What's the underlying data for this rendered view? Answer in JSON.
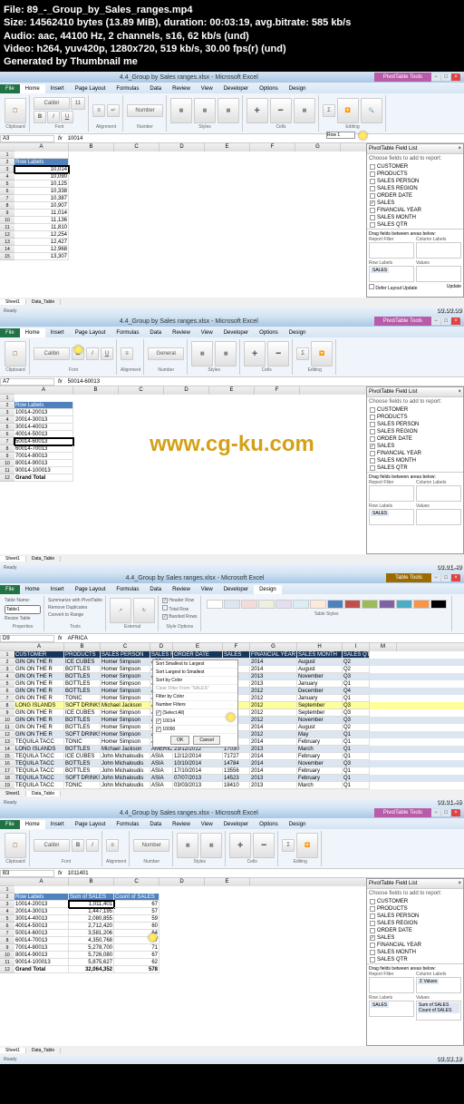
{
  "meta": {
    "file_line": "File: 89_-_Group_by_Sales_ranges.mp4",
    "size_line": "Size: 14562410 bytes (13.89 MiB), duration: 00:03:19, avg.bitrate: 585 kb/s",
    "audio_line": "Audio: aac, 44100 Hz, 2 channels, s16, 62 kb/s (und)",
    "video_line": "Video: h264, yuv420p, 1280x720, 519 kb/s, 30.00 fps(r) (und)",
    "gen_line": "Generated by Thumbnail me"
  },
  "watermark": "www.cg-ku.com",
  "title": "4.4_Group by Sales ranges.xlsx - Microsoft Excel",
  "pivot_tools": "PivotTable Tools",
  "tabs": [
    "File",
    "Home",
    "Insert",
    "Page Layout",
    "Formulas",
    "Data",
    "Review",
    "View",
    "Developer",
    "Options",
    "Design"
  ],
  "field_list": {
    "title": "PivotTable Field List",
    "prompt": "Choose fields to add to report:",
    "fields": [
      "CUSTOMER",
      "PRODUCTS",
      "SALES PERSON",
      "SALES REGION",
      "ORDER DATE",
      "SALES",
      "FINANCIAL YEAR",
      "SALES MONTH",
      "SALES QTR"
    ],
    "drag_label": "Drag fields between areas below:",
    "report_filter": "Report Filter",
    "column_labels": "Column Labels",
    "row_labels": "Row Labels",
    "values": "Values",
    "defer": "Defer Layout Update",
    "update": "Update"
  },
  "panel1": {
    "name_box": "A3",
    "formula": "10014",
    "row_labels_header": "Row Labels",
    "rows": [
      "10,014",
      "10,090",
      "10,125",
      "10,338",
      "10,387",
      "10,907",
      "11,014",
      "11,136",
      "11,810",
      "12,254",
      "12,427",
      "12,968",
      "13,307"
    ],
    "row1_input": "Row 1",
    "timestamp": "00.00.00"
  },
  "panel2": {
    "name_box": "A7",
    "formula": "50014-60013",
    "header": "Row Labels",
    "rows": [
      "10014-20013",
      "20014-30013",
      "30014-40013",
      "40014-50013",
      "50014-60013",
      "60014-70013",
      "70014-80013",
      "80014-90013",
      "90014-100013",
      "Grand Total"
    ],
    "timestamp": "00.01.40"
  },
  "panel3": {
    "name_box": "D9",
    "formula": "AFRICA",
    "headers": [
      "CUSTOMER",
      "PRODUCTS",
      "SALES PERSON",
      "SALES REGION",
      "ORDER DATE",
      "SALES",
      "FINANCIAL YEAR",
      "SALES MONTH",
      "SALES QTR"
    ],
    "rows": [
      {
        "customer": "GIN ON THE R",
        "prod": "ICE CUBES",
        "person": "Homer Simpson",
        "region": "AFRI",
        "year": "2014",
        "month": "August",
        "qtr": "Q2"
      },
      {
        "customer": "GIN ON THE R",
        "prod": "BOTTLES",
        "person": "Homer Simpson",
        "region": "AFRI",
        "year": "2014",
        "month": "August",
        "qtr": "Q2"
      },
      {
        "customer": "GIN ON THE R",
        "prod": "BOTTLES",
        "person": "Homer Simpson",
        "region": "AFRI",
        "year": "2013",
        "month": "November",
        "qtr": "Q3"
      },
      {
        "customer": "GIN ON THE R",
        "prod": "BOTTLES",
        "person": "Homer Simpson",
        "region": "AFRI",
        "year": "2013",
        "month": "January",
        "qtr": "Q1"
      },
      {
        "customer": "GIN ON THE R",
        "prod": "BOTTLES",
        "person": "Homer Simpson",
        "region": "AFRI",
        "year": "2012",
        "month": "December",
        "qtr": "Q4"
      },
      {
        "customer": "GIN ON THE R",
        "prod": "TONIC",
        "person": "Homer Simpson",
        "region": "AFRI",
        "year": "2012",
        "month": "January",
        "qtr": "Q1"
      },
      {
        "customer": "LONG ISLANDS",
        "prod": "SOFT DRINKS",
        "person": "Michael Jackson",
        "region": "AME",
        "year": "2012",
        "month": "September",
        "qtr": "Q3"
      },
      {
        "customer": "GIN ON THE R",
        "prod": "ICE CUBES",
        "person": "Homer Simpson",
        "region": "AFRI",
        "year": "2012",
        "month": "September",
        "qtr": "Q3"
      },
      {
        "customer": "GIN ON THE R",
        "prod": "BOTTLES",
        "person": "Homer Simpson",
        "region": "AFRI",
        "year": "2012",
        "month": "November",
        "qtr": "Q3"
      },
      {
        "customer": "GIN ON THE R",
        "prod": "BOTTLES",
        "person": "Homer Simpson",
        "region": "AFRI",
        "year": "2014",
        "month": "August",
        "qtr": "Q2"
      },
      {
        "customer": "GIN ON THE R",
        "prod": "SOFT DRINKS",
        "person": "Homer Simpson",
        "region": "AFRI",
        "year": "2012",
        "month": "May",
        "qtr": "Q1"
      },
      {
        "customer": "TEQUILA TACC",
        "prod": "TONIC",
        "person": "Homer Simpson",
        "region": "AFRI",
        "year": "2014",
        "month": "February",
        "qtr": "Q1"
      }
    ],
    "extra_rows": [
      {
        "customer": "LONG ISLANDS",
        "prod": "BOTTLES",
        "person": "Michael Jackson",
        "region": "AMERICAS",
        "date": "23/12/2012",
        "sales": "17030",
        "year": "2013",
        "month": "March",
        "qtr": "Q1"
      },
      {
        "customer": "TEQUILA TACC",
        "prod": "ICE CUBES",
        "person": "John Michaloudis",
        "region": "ASIA",
        "date": "12/12/2014",
        "sales": "71727",
        "year": "2014",
        "month": "February",
        "qtr": "Q1"
      },
      {
        "customer": "TEQUILA TACC",
        "prod": "BOTTLES",
        "person": "John Michaloudis",
        "region": "ASIA",
        "date": "10/10/2014",
        "sales": "14784",
        "year": "2014",
        "month": "November",
        "qtr": "Q3"
      },
      {
        "customer": "TEQUILA TACC",
        "prod": "BOTTLES",
        "person": "John Michaloudis",
        "region": "ASIA",
        "date": "17/10/2014",
        "sales": "13556",
        "year": "2014",
        "month": "February",
        "qtr": "Q1"
      },
      {
        "customer": "TEQUILA TACC",
        "prod": "SOFT DRINKS",
        "person": "John Michaloudis",
        "region": "ASIA",
        "date": "07/07/2013",
        "sales": "14523",
        "year": "2013",
        "month": "February",
        "qtr": "Q1"
      },
      {
        "customer": "TEQUILA TACC",
        "prod": "TONIC",
        "person": "John Michaloudis",
        "region": "ASIA",
        "date": "03/03/2013",
        "sales": "18410",
        "year": "2013",
        "month": "March",
        "qtr": "Q1"
      }
    ],
    "filter": {
      "sort_asc": "Sort Smallest to Largest",
      "sort_desc": "Sort Largest to Smallest",
      "sort_color": "Sort by Color",
      "clear": "Clear Filter From \"SALES\"",
      "filter_color": "Filter by Color",
      "number_filters": "Number Filters",
      "select_all": "(Select All)",
      "v1": "10014",
      "v2": "10090",
      "ok": "OK",
      "cancel": "Cancel"
    },
    "timestamp": "00.01.46"
  },
  "panel4": {
    "name_box": "B3",
    "formula": "1011401",
    "headers": [
      "Row Labels",
      "Sum of SALES",
      "Count of SALES"
    ],
    "rows": [
      {
        "label": "10014-20013",
        "sum": "1,011,401",
        "count": "67"
      },
      {
        "label": "20014-30013",
        "sum": "1,447,195",
        "count": "57"
      },
      {
        "label": "30014-40013",
        "sum": "2,080,855",
        "count": "59"
      },
      {
        "label": "40014-50013",
        "sum": "2,712,420",
        "count": "60"
      },
      {
        "label": "50014-60013",
        "sum": "3,581,206",
        "count": "64"
      },
      {
        "label": "60014-70013",
        "sum": "4,350,768",
        "count": "67"
      },
      {
        "label": "70014-80013",
        "sum": "5,278,700",
        "count": "71"
      },
      {
        "label": "80014-90013",
        "sum": "5,726,080",
        "count": "67"
      },
      {
        "label": "90014-100013",
        "sum": "5,875,627",
        "count": "62"
      },
      {
        "label": "Grand Total",
        "sum": "32,064,352",
        "count": "578"
      }
    ],
    "sum_of_sales": "Sum of SALES",
    "count_of_sales": "Count of SALES",
    "timestamp": "00.03.19"
  },
  "sheets": [
    "Sheet1",
    "Data_Table"
  ],
  "status": "Ready",
  "colors": {
    "accent": "#4f81bd",
    "context": "#b85ba8",
    "green": "#217346"
  }
}
